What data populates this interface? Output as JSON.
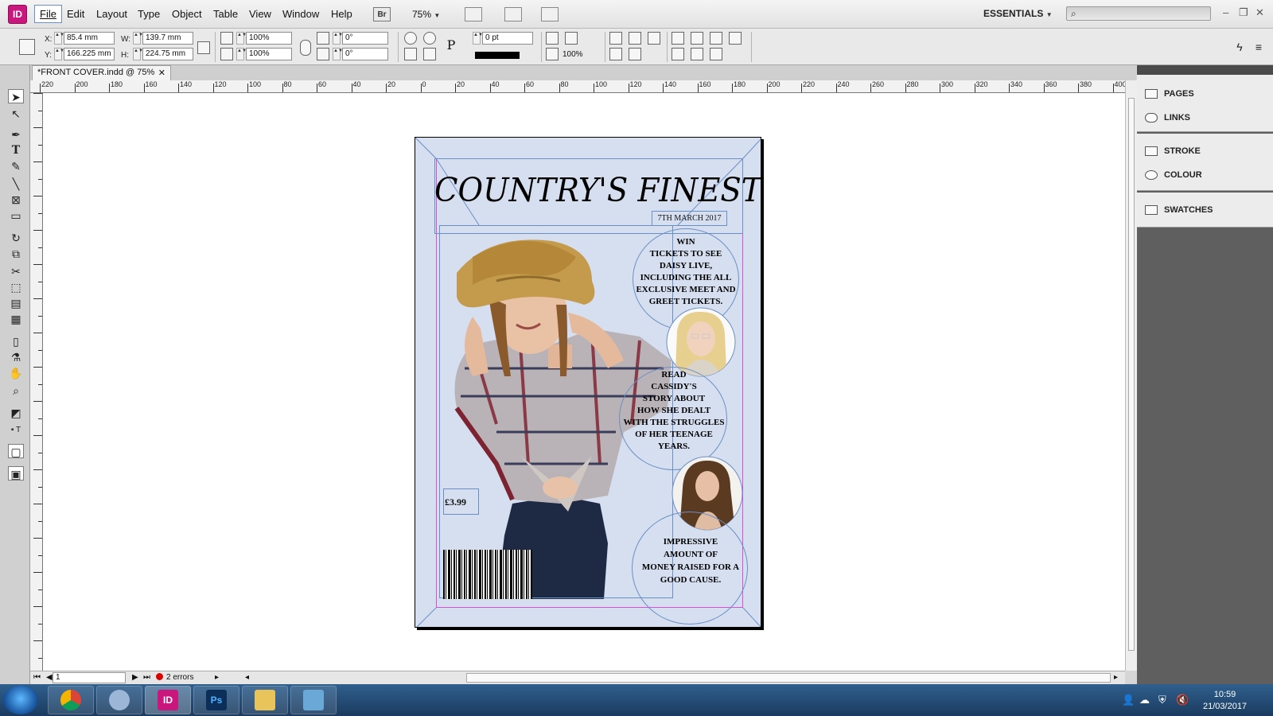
{
  "app": {
    "logo": "ID",
    "menus": [
      "File",
      "Edit",
      "Layout",
      "Type",
      "Object",
      "Table",
      "View",
      "Window",
      "Help"
    ],
    "bridge_label": "Br",
    "zoom": "75%",
    "workspace": "ESSENTIALS"
  },
  "control": {
    "x_label": "X:",
    "x_value": "85.4 mm",
    "y_label": "Y:",
    "y_value": "166.225 mm",
    "w_label": "W:",
    "w_value": "139.7 mm",
    "h_label": "H:",
    "h_value": "224.75 mm",
    "scale_x": "100%",
    "scale_y": "100%",
    "rotate": "0°",
    "shear": "0°",
    "stroke_weight": "0 pt",
    "opacity": "100%"
  },
  "document": {
    "tab_title": "*FRONT COVER.indd @ 75%",
    "close": "✕"
  },
  "ruler": {
    "h": [
      "220",
      "200",
      "180",
      "160",
      "140",
      "120",
      "100",
      "80",
      "60",
      "40",
      "20",
      "0",
      "20",
      "40",
      "60",
      "80",
      "100",
      "120",
      "140",
      "160",
      "180",
      "200",
      "220",
      "240",
      "260",
      "280",
      "300",
      "320",
      "340",
      "360",
      "380",
      "400"
    ]
  },
  "cover": {
    "masthead": "COUNTRY'S FINEST",
    "date": "7TH MARCH 2017",
    "line1": [
      "WIN",
      "TICKETS TO SEE",
      "DAISY LIVE,",
      "INCLUDING THE ALL",
      "EXCLUSIVE MEET AND",
      "GREET TICKETS."
    ],
    "line2": [
      "READ",
      "CASSIDY'S",
      "STORY ABOUT",
      "HOW SHE DEALT",
      "WITH THE STRUGGLES",
      "OF HER TEENAGE",
      "YEARS."
    ],
    "line3": [
      "IMPRESSIVE",
      "AMOUNT OF",
      "MONEY RAISED FOR A",
      "GOOD CAUSE."
    ],
    "price": "£3.99"
  },
  "panels": {
    "pages": "PAGES",
    "links": "LINKS",
    "stroke": "STROKE",
    "colour": "COLOUR",
    "swatches": "SWATCHES"
  },
  "status": {
    "page": "1",
    "errors": "2 errors"
  },
  "taskbar": {
    "time": "10:59",
    "date": "21/03/2017",
    "indesign": "ID",
    "photoshop": "Ps"
  },
  "colors": {
    "indesign": "#c9177e",
    "page_bg": "#d6dff0",
    "frame": "#6b8fc5",
    "margin": "#d84fd8"
  }
}
